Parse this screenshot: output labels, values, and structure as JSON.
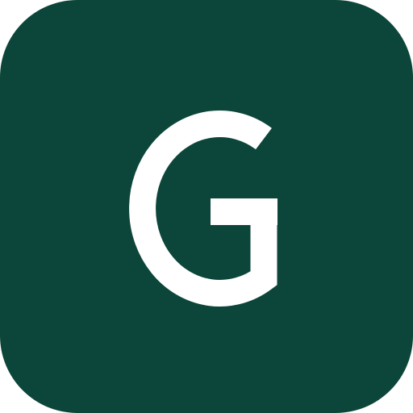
{
  "icon": {
    "letter": "G",
    "background_color": "#0c463a",
    "foreground_color": "#ffffff",
    "icon_name": "letter-g-app-icon"
  }
}
